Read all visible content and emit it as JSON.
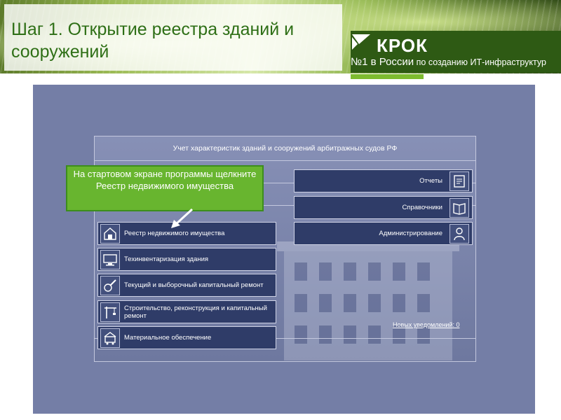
{
  "slide": {
    "title": "Шаг 1. Открытие реестра зданий и\nсооружений"
  },
  "brand": {
    "name": "КРОК",
    "slogan_prefix": "№1 в России",
    "slogan_rest": " по созданию ИТ-инфраструктур",
    "color": "#2e5a14",
    "accent": "#7dbb2f"
  },
  "app": {
    "title": "Учет характеристик зданий и сооружений арбитражных судов РФ",
    "left_tiles": [
      {
        "label": "Реестр недвижимого имущества",
        "icon": "building-registry-icon"
      },
      {
        "label": "Техинвентаризация здания",
        "icon": "monitor-icon"
      },
      {
        "label": "Текущий и выборочный капитальный ремонт",
        "icon": "repair-tools-icon"
      },
      {
        "label": "Строительство, реконструкция и капитальный ремонт",
        "icon": "crane-icon"
      },
      {
        "label": "Материальное обеспечение",
        "icon": "supply-cart-icon"
      }
    ],
    "right_tiles": [
      {
        "label": "Отчеты",
        "icon": "report-icon"
      },
      {
        "label": "Справочники",
        "icon": "book-icon"
      },
      {
        "label": "Администрирование",
        "icon": "admin-user-icon"
      }
    ],
    "notifications_link": "Новых уведомлений: 0"
  },
  "callout": {
    "text": "На стартовом экране программы щелкните Реестр недвижимого имущества"
  }
}
